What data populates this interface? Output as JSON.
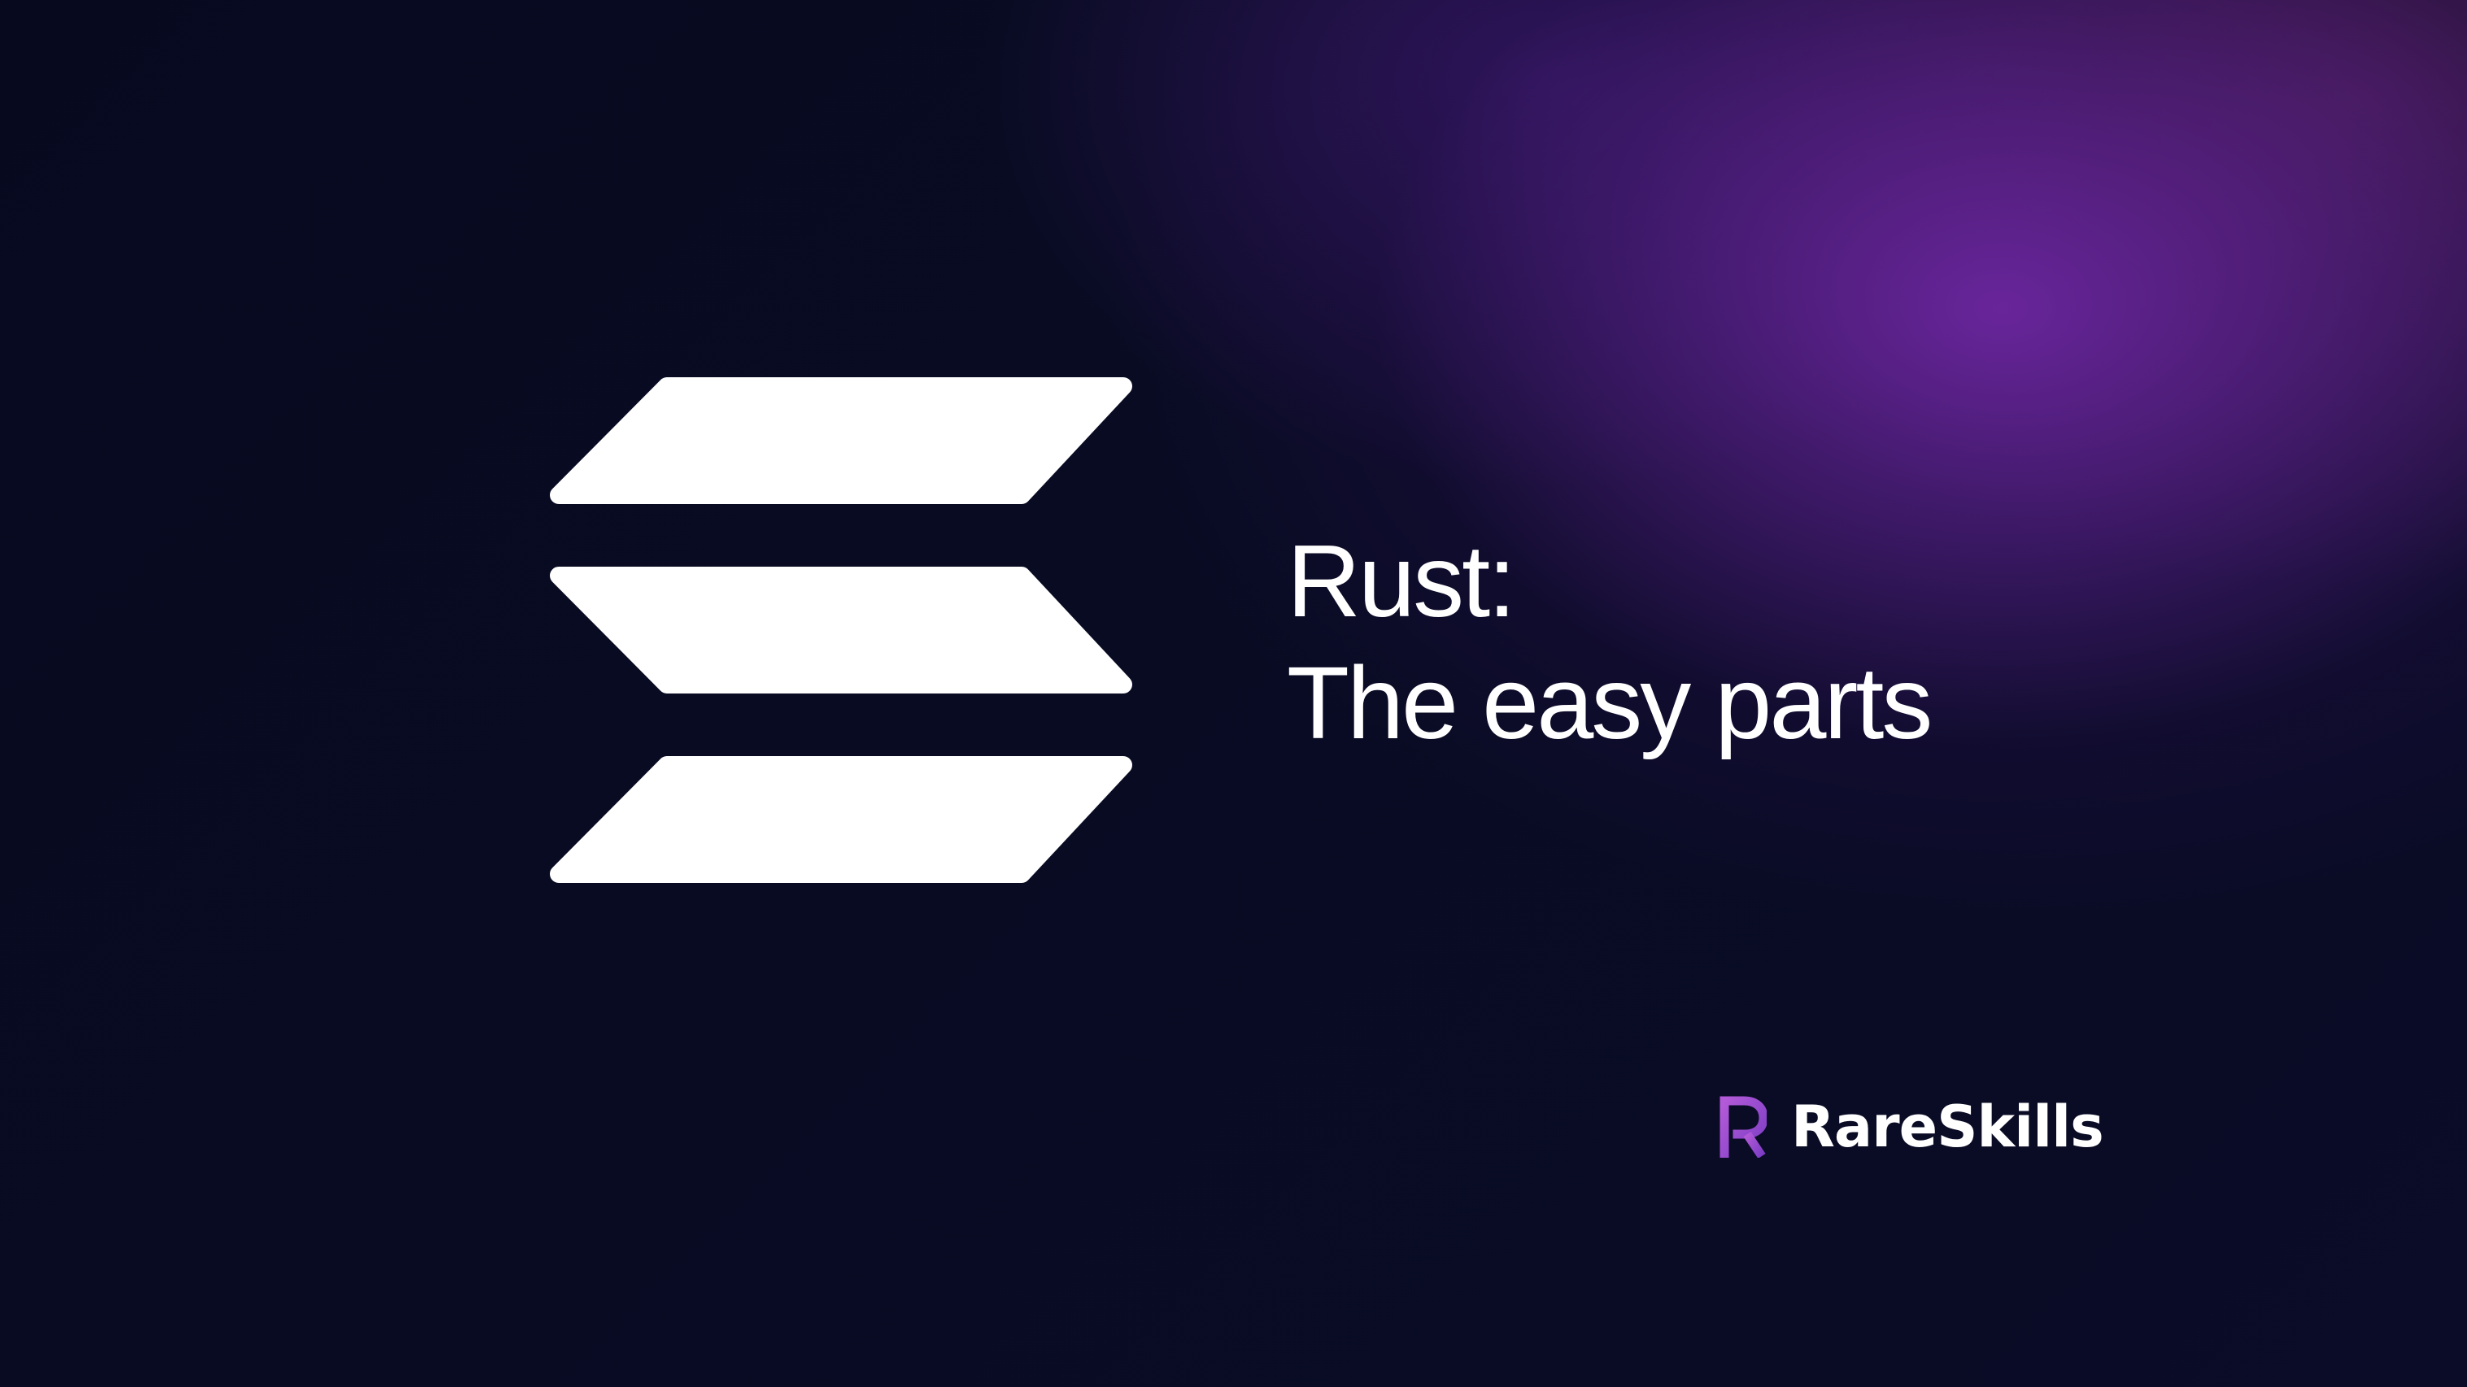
{
  "slide": {
    "title_line1": "Rust:",
    "title_line2": "The easy parts"
  },
  "brand": {
    "name": "RareSkills",
    "icon": "rareskills-r-icon",
    "accent_color": "#9b4fd0"
  },
  "logo": {
    "icon": "solana-logo-icon",
    "color": "#ffffff"
  },
  "colors": {
    "background": "#080b22",
    "glow": "#6c26a0",
    "text": "#ffffff"
  }
}
